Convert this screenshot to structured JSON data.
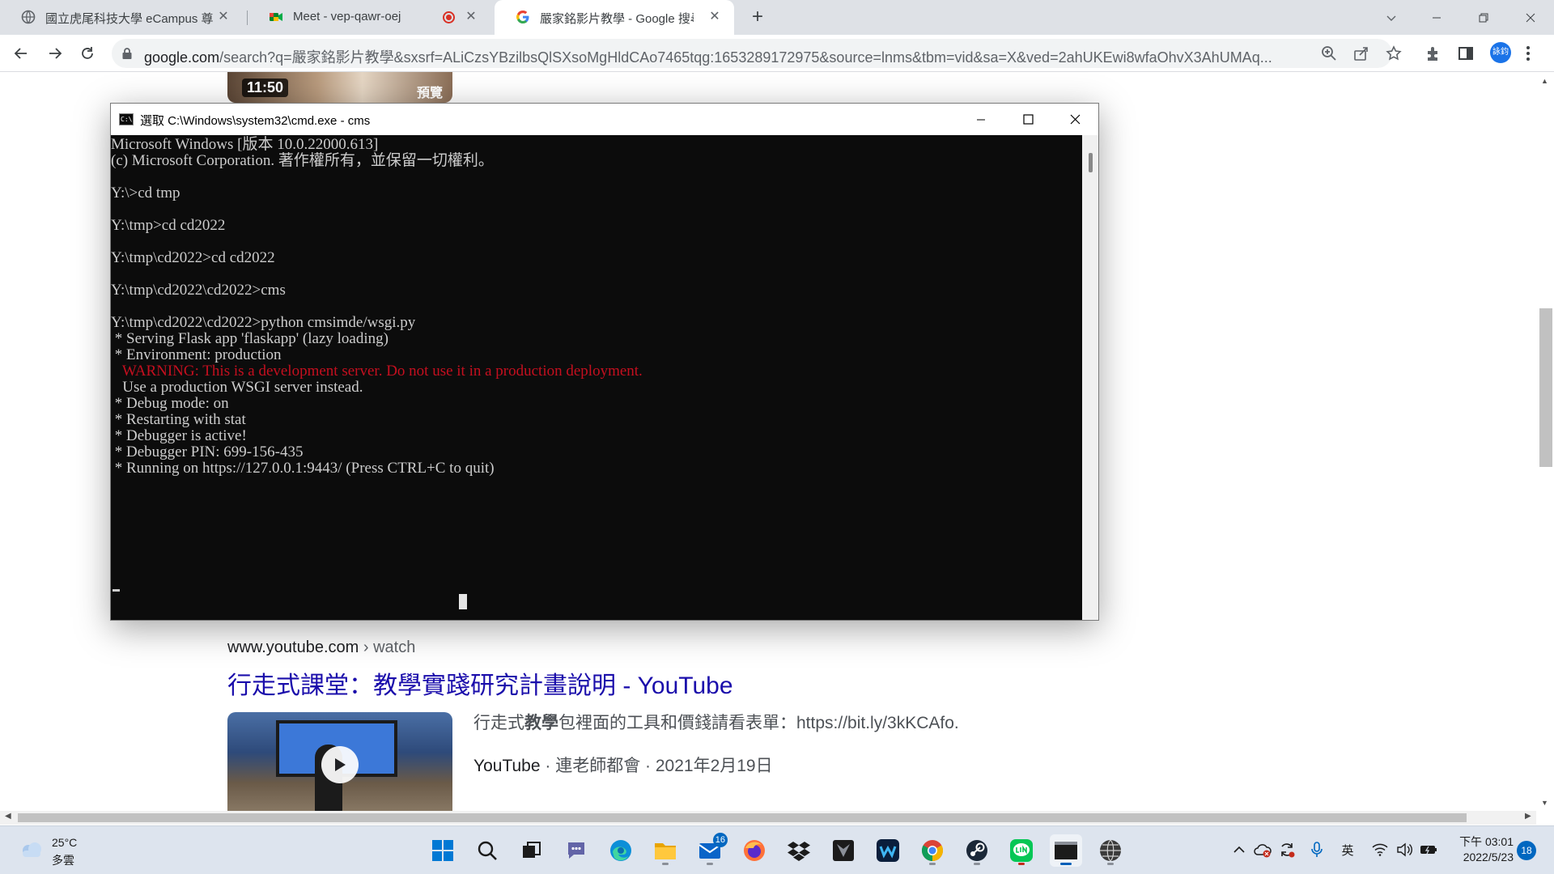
{
  "browser": {
    "tabs": [
      {
        "title": "國立虎尾科技大學 eCampus 尊",
        "icon": "globe-icon"
      },
      {
        "title": "Meet - vep-qawr-oej",
        "icon": "meet-icon",
        "recording": true
      },
      {
        "title": "嚴家銘影片教學 - Google 搜尋",
        "icon": "google-icon",
        "active": true
      }
    ],
    "url_host": "google.com",
    "url_rest": "/search?q=嚴家銘影片教學&sxsrf=ALiCzsYBzilbsQlSXsoMgHldCAo7465tqg:1653289172975&source=lnms&tbm=vid&sa=X&ved=2ahUKEwi8wfaOhvX3AhUMAq...",
    "profile_initials": "詠鈞",
    "accent": "#1a73e8"
  },
  "page": {
    "top_result": {
      "duration": "11:50",
      "preview": "預覽"
    },
    "result": {
      "site": "www.youtube.com",
      "crumb": " › watch",
      "title": "行走式課堂：教學實踐研究計畫說明 - YouTube",
      "snippet_pre": "行走式",
      "snippet_bold": "教學",
      "snippet_post": "包裡面的工具和價錢請看表單：https://bit.ly/3kKCAfo.",
      "meta_source": "YouTube",
      "meta_rest": " · 連老師都會 · 2021年2月19日",
      "link_color": "#1a0dab"
    }
  },
  "cmd": {
    "caption": "選取 C:\\Windows\\system32\\cmd.exe - cms",
    "lines": [
      {
        "text": "Microsoft Windows [版本 10.0.22000.613]"
      },
      {
        "text": "(c) Microsoft Corporation. 著作權所有，並保留一切權利。"
      },
      {
        "text": ""
      },
      {
        "text": "Y:\\>cd tmp"
      },
      {
        "text": ""
      },
      {
        "text": "Y:\\tmp>cd cd2022"
      },
      {
        "text": ""
      },
      {
        "text": "Y:\\tmp\\cd2022>cd cd2022"
      },
      {
        "text": ""
      },
      {
        "text": "Y:\\tmp\\cd2022\\cd2022>cms"
      },
      {
        "text": ""
      },
      {
        "text": "Y:\\tmp\\cd2022\\cd2022>python cmsimde/wsgi.py"
      },
      {
        "text": " * Serving Flask app 'flaskapp' (lazy loading)"
      },
      {
        "text": " * Environment: production"
      },
      {
        "text": "   WARNING: This is a development server. Do not use it in a production deployment.",
        "warn": true
      },
      {
        "text": "   Use a production WSGI server instead."
      },
      {
        "text": " * Debug mode: on"
      },
      {
        "text": " * Restarting with stat"
      },
      {
        "text": " * Debugger is active!"
      },
      {
        "text": " * Debugger PIN: 699-156-435"
      },
      {
        "text": " * Running on https://127.0.0.1:9443/ (Press CTRL+C to quit)"
      }
    ],
    "warning_color": "#c50f1f"
  },
  "taskbar": {
    "weather_temp": "25°C",
    "weather_cond": "多雲",
    "apps": [
      {
        "name": "start",
        "icon": "windows-start-icon"
      },
      {
        "name": "search",
        "icon": "search-icon"
      },
      {
        "name": "task-view",
        "icon": "task-view-icon"
      },
      {
        "name": "chat",
        "icon": "teams-chat-icon"
      },
      {
        "name": "edge",
        "icon": "edge-icon"
      },
      {
        "name": "file-explorer",
        "icon": "folder-icon"
      },
      {
        "name": "mail",
        "icon": "mail-icon",
        "badge": "16"
      },
      {
        "name": "firefox",
        "icon": "firefox-icon"
      },
      {
        "name": "dropbox",
        "icon": "dropbox-icon"
      },
      {
        "name": "predator",
        "icon": "predator-icon"
      },
      {
        "name": "webex",
        "icon": "webex-icon"
      },
      {
        "name": "chrome",
        "icon": "chrome-icon"
      },
      {
        "name": "steam",
        "icon": "steam-icon"
      },
      {
        "name": "line",
        "icon": "line-icon"
      },
      {
        "name": "terminal",
        "icon": "terminal-icon"
      },
      {
        "name": "globe-app",
        "icon": "globe-dark-icon"
      }
    ],
    "tray": {
      "ime": "英"
    },
    "clock_time": "下午 03:01",
    "clock_date": "2022/5/23",
    "notifications": "18"
  }
}
